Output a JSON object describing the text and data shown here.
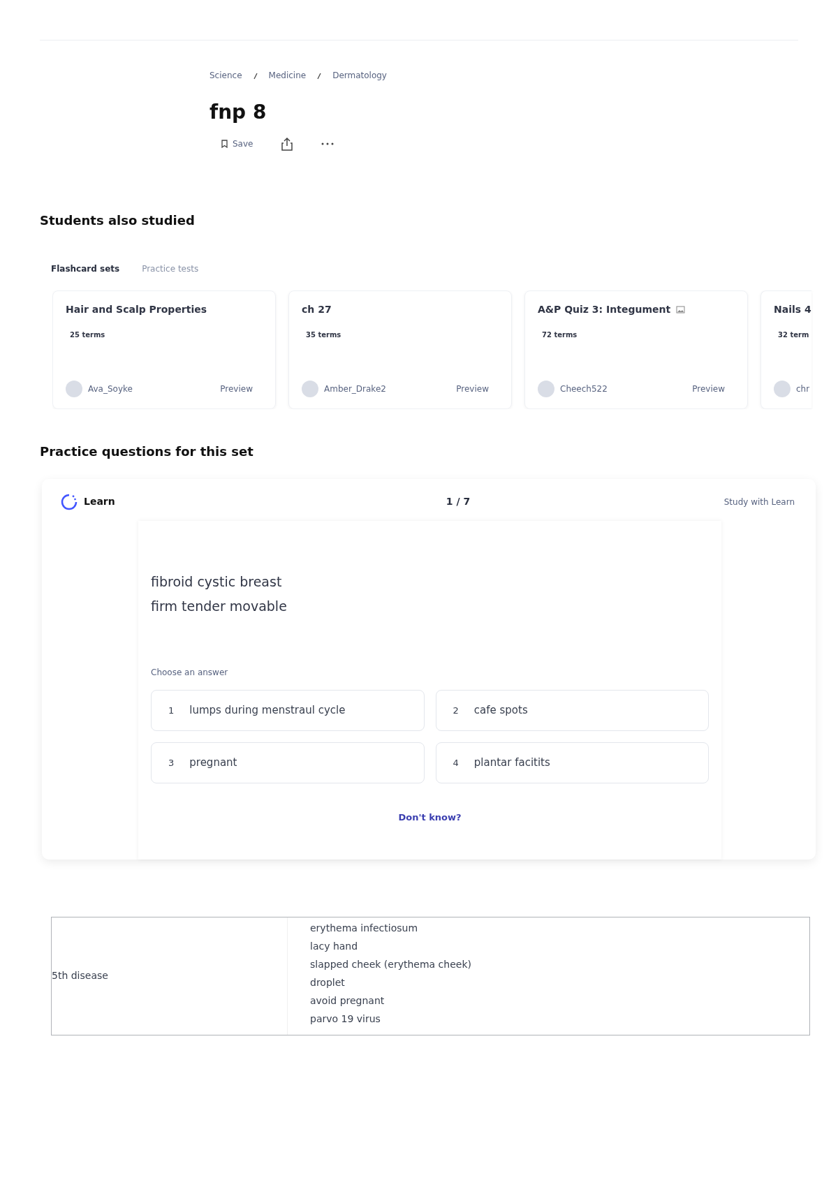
{
  "breadcrumb": [
    "Science",
    "Medicine",
    "Dermatology"
  ],
  "title": "fnp 8",
  "actions": {
    "save": "Save"
  },
  "students_also_studied": {
    "heading": "Students also studied",
    "tabs": [
      {
        "label": "Flashcard sets",
        "selected": true
      },
      {
        "label": "Practice tests",
        "selected": false
      }
    ],
    "cards": [
      {
        "title": "Hair and Scalp Properties",
        "has_image": false,
        "terms": "25 terms",
        "author": "Ava_Soyke",
        "preview": "Preview"
      },
      {
        "title": "ch 27",
        "has_image": false,
        "terms": "35 terms",
        "author": "Amber_Drake2",
        "preview": "Preview"
      },
      {
        "title": "A&P Quiz 3: Integument",
        "has_image": true,
        "terms": "72 terms",
        "author": "Cheech522",
        "preview": "Preview"
      },
      {
        "title": "Nails 4",
        "has_image": false,
        "terms": "32 term",
        "author": "chr"
      }
    ]
  },
  "practice": {
    "heading": "Practice questions for this set",
    "mode": "Learn",
    "progress": "1 / 7",
    "study_link": "Study with Learn",
    "question": [
      "fibroid cystic breast",
      "firm tender movable"
    ],
    "prompt": "Choose an answer",
    "answers": [
      {
        "number": "1",
        "text": "lumps during menstraul cycle"
      },
      {
        "number": "2",
        "text": "cafe spots"
      },
      {
        "number": "3",
        "text": "pregnant"
      },
      {
        "number": "4",
        "text": "plantar facitits"
      }
    ],
    "dont_know": "Don't know?"
  },
  "table": {
    "rows": [
      {
        "term": "5th disease",
        "definition": [
          "erythema infectiosum",
          "lacy hand",
          "slapped cheek (erythema cheek)",
          "droplet",
          "avoid pregnant",
          "parvo 19 virus"
        ]
      }
    ]
  }
}
